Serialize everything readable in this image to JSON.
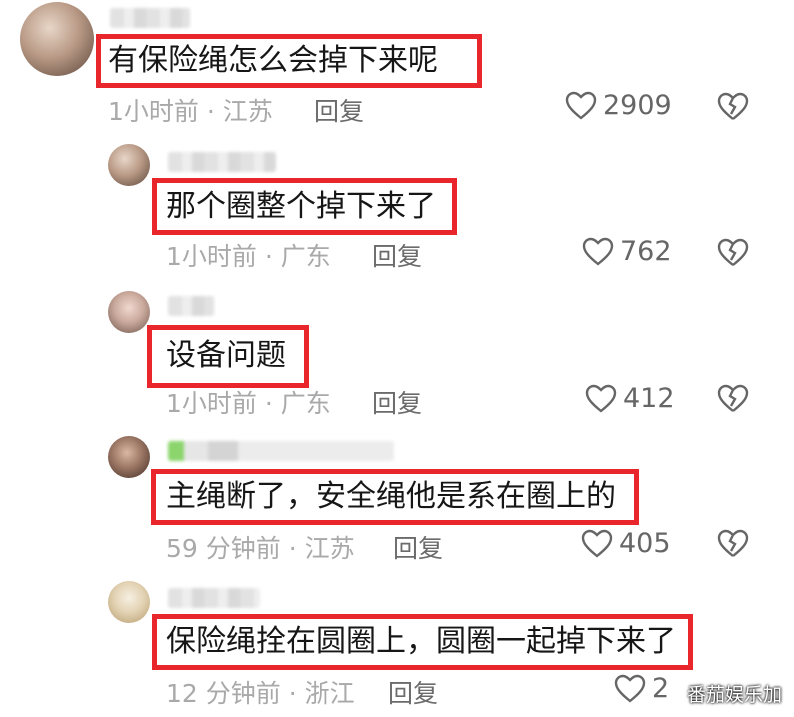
{
  "comments": [
    {
      "text": "有保险绳怎么会掉下来呢",
      "time": "1小时前",
      "location": "江苏",
      "reply": "回复",
      "likes": "2909"
    },
    {
      "text": "那个圈整个掉下来了",
      "time": "1小时前",
      "location": "广东",
      "reply": "回复",
      "likes": "762"
    },
    {
      "text": "设备问题",
      "time": "1小时前",
      "location": "广东",
      "reply": "回复",
      "likes": "412"
    },
    {
      "text": "主绳断了，安全绳他是系在圈上的",
      "time": "59 分钟前",
      "location": "江苏",
      "reply": "回复",
      "likes": "405"
    },
    {
      "text": "保险绳拴在圆圈上，圆圈一起掉下来了",
      "time": "12 分钟前",
      "location": "浙江",
      "reply": "回复",
      "likes": "2"
    }
  ],
  "separator": "·",
  "watermark": "番茄娱乐加",
  "colors": {
    "highlight": "#e8262c",
    "meta": "#a9a9a9"
  },
  "icons": {
    "like": "heart-outline-icon",
    "dislike": "broken-heart-icon"
  }
}
